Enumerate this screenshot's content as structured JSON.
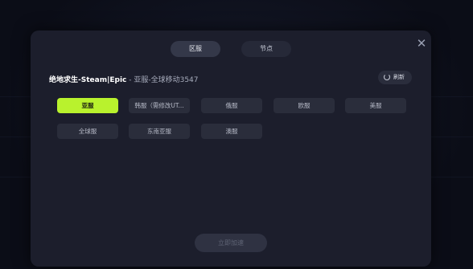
{
  "modal": {
    "tabs": [
      {
        "label": "区服"
      },
      {
        "label": "节点"
      }
    ],
    "title": {
      "game": "绝地求生-Steam|Epic",
      "separator": " - ",
      "selection": "亚服-全球移动3547"
    },
    "refresh_label": "刷新",
    "regions": [
      {
        "label": "亚服"
      },
      {
        "label": "韩服（需修改UT..."
      },
      {
        "label": "俄服"
      },
      {
        "label": "欧服"
      },
      {
        "label": "美服"
      },
      {
        "label": "全球服"
      },
      {
        "label": "东南亚服"
      },
      {
        "label": "澳服"
      }
    ],
    "confirm_label": "立即加速"
  },
  "colors": {
    "accent": "#b9f22d",
    "modal_bg": "#1c1e2c",
    "chip_bg": "#2a2d3b"
  }
}
